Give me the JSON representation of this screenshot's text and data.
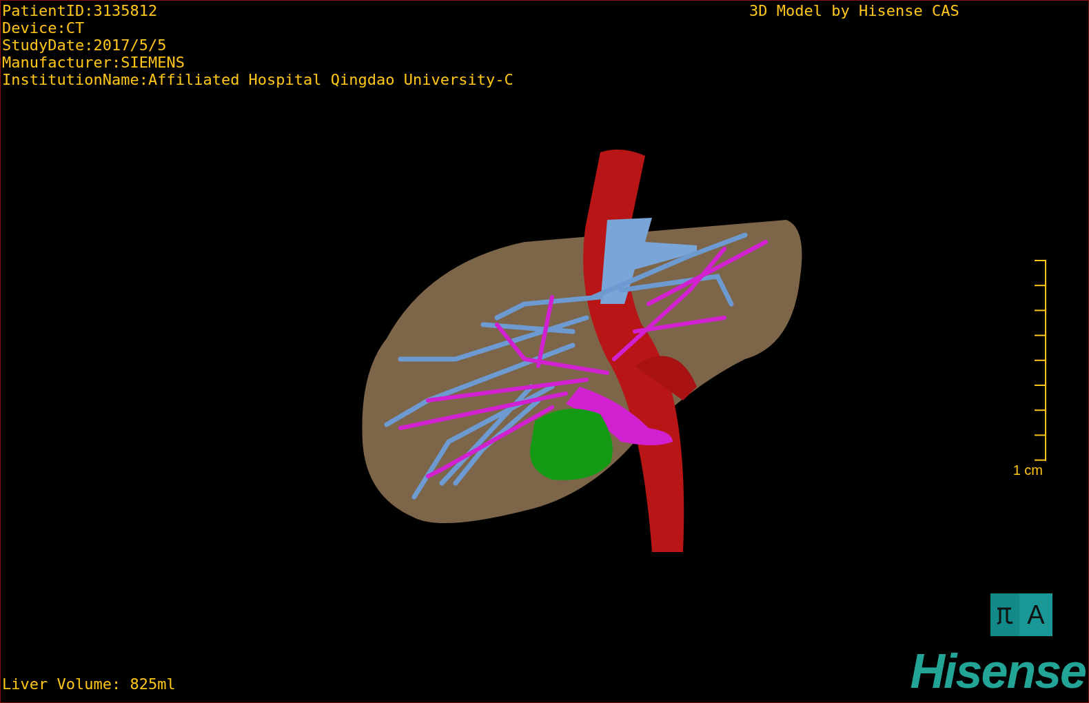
{
  "patient_info": [
    "PatientID:3135812",
    "Device:CT",
    "StudyDate:2017/5/5",
    "Manufacturer:SIEMENS",
    "InstitutionName:Affiliated Hospital Qingdao University-C"
  ],
  "title": "3D Model by Hisense CAS",
  "scale_bar": {
    "label": "1 cm"
  },
  "orientation_cube": {
    "face_label": "A"
  },
  "liver_volume": "Liver Volume: 825ml",
  "logo": "Hisense"
}
